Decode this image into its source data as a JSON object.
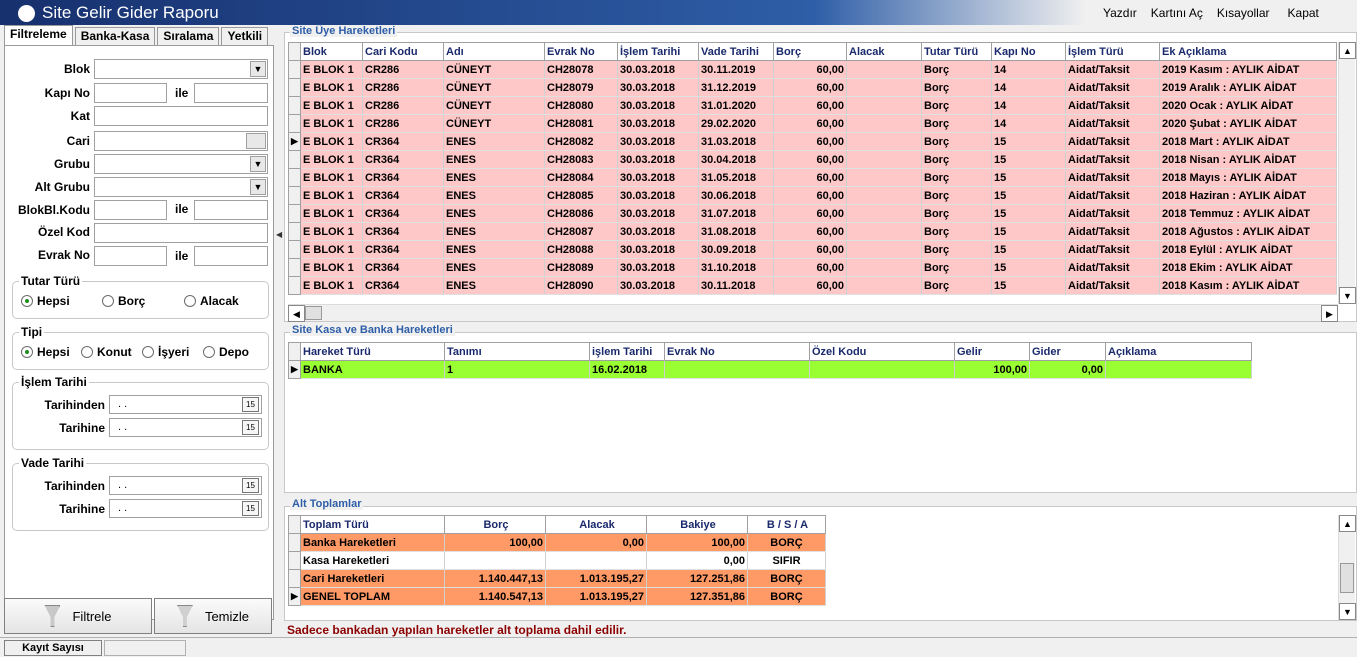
{
  "window": {
    "title": "Site Gelir Gider Raporu"
  },
  "menu": [
    "Yazdır",
    "Kartını Aç",
    "Kısayollar",
    "Kapat"
  ],
  "tabs": [
    "Filtreleme",
    "Banka-Kasa",
    "Sıralama",
    "Yetkili"
  ],
  "filters": {
    "blok": "Blok",
    "kapi_no": "Kapı No",
    "ile": "ile",
    "kat": "Kat",
    "cari": "Cari",
    "grubu": "Grubu",
    "alt_grubu": "Alt Grubu",
    "blokbl_kodu": "BlokBl.Kodu",
    "ozel_kod": "Özel Kod",
    "evrak_no": "Evrak No"
  },
  "tutar_turu": {
    "title": "Tutar Türü",
    "options": [
      "Hepsi",
      "Borç",
      "Alacak"
    ],
    "selected": "Hepsi"
  },
  "tipi": {
    "title": "Tipi",
    "options": [
      "Hepsi",
      "Konut",
      "İşyeri",
      "Depo"
    ],
    "selected": "Hepsi"
  },
  "islem_tarihi": {
    "title": "İşlem Tarihi",
    "from_label": "Tarihinden",
    "to_label": "Tarihine",
    "from_value": ". .",
    "to_value": ". ."
  },
  "vade_tarihi": {
    "title": "Vade Tarihi",
    "from_label": "Tarihinden",
    "to_label": "Tarihine",
    "from_value": ". .",
    "to_value": ". ."
  },
  "buttons": {
    "filtrele": "Filtrele",
    "temizle": "Temizle"
  },
  "uye_hareketleri": {
    "title": "Site Üye Hareketleri",
    "columns": [
      "Blok",
      "Cari Kodu",
      "Adı",
      "Evrak No",
      "İşlem Tarihi",
      "Vade Tarihi",
      "Borç",
      "Alacak",
      "Tutar Türü",
      "Kapı No",
      "İşlem Türü",
      "Ek Açıklama"
    ],
    "rows": [
      [
        "E BLOK 1",
        "CR286",
        "CÜNEYT",
        "CH28078",
        "30.03.2018",
        "30.11.2019",
        "60,00",
        "",
        "Borç",
        "14",
        "Aidat/Taksit",
        "2019 Kasım : AYLIK AİDAT"
      ],
      [
        "E BLOK 1",
        "CR286",
        "CÜNEYT",
        "CH28079",
        "30.03.2018",
        "31.12.2019",
        "60,00",
        "",
        "Borç",
        "14",
        "Aidat/Taksit",
        "2019 Aralık : AYLIK AİDAT"
      ],
      [
        "E BLOK 1",
        "CR286",
        "CÜNEYT",
        "CH28080",
        "30.03.2018",
        "31.01.2020",
        "60,00",
        "",
        "Borç",
        "14",
        "Aidat/Taksit",
        "2020 Ocak : AYLIK AİDAT"
      ],
      [
        "E BLOK 1",
        "CR286",
        "CÜNEYT",
        "CH28081",
        "30.03.2018",
        "29.02.2020",
        "60,00",
        "",
        "Borç",
        "14",
        "Aidat/Taksit",
        "2020 Şubat : AYLIK AİDAT"
      ],
      [
        "E BLOK 1",
        "CR364",
        "ENES",
        "CH28082",
        "30.03.2018",
        "31.03.2018",
        "60,00",
        "",
        "Borç",
        "15",
        "Aidat/Taksit",
        "2018 Mart : AYLIK AİDAT"
      ],
      [
        "E BLOK 1",
        "CR364",
        "ENES",
        "CH28083",
        "30.03.2018",
        "30.04.2018",
        "60,00",
        "",
        "Borç",
        "15",
        "Aidat/Taksit",
        "2018 Nisan : AYLIK AİDAT"
      ],
      [
        "E BLOK 1",
        "CR364",
        "ENES",
        "CH28084",
        "30.03.2018",
        "31.05.2018",
        "60,00",
        "",
        "Borç",
        "15",
        "Aidat/Taksit",
        "2018 Mayıs : AYLIK AİDAT"
      ],
      [
        "E BLOK 1",
        "CR364",
        "ENES",
        "CH28085",
        "30.03.2018",
        "30.06.2018",
        "60,00",
        "",
        "Borç",
        "15",
        "Aidat/Taksit",
        "2018 Haziran : AYLIK AİDAT"
      ],
      [
        "E BLOK 1",
        "CR364",
        "ENES",
        "CH28086",
        "30.03.2018",
        "31.07.2018",
        "60,00",
        "",
        "Borç",
        "15",
        "Aidat/Taksit",
        "2018 Temmuz : AYLIK AİDAT"
      ],
      [
        "E BLOK 1",
        "CR364",
        "ENES",
        "CH28087",
        "30.03.2018",
        "31.08.2018",
        "60,00",
        "",
        "Borç",
        "15",
        "Aidat/Taksit",
        "2018 Ağustos : AYLIK AİDAT"
      ],
      [
        "E BLOK 1",
        "CR364",
        "ENES",
        "CH28088",
        "30.03.2018",
        "30.09.2018",
        "60,00",
        "",
        "Borç",
        "15",
        "Aidat/Taksit",
        "2018 Eylül : AYLIK AİDAT"
      ],
      [
        "E BLOK 1",
        "CR364",
        "ENES",
        "CH28089",
        "30.03.2018",
        "31.10.2018",
        "60,00",
        "",
        "Borç",
        "15",
        "Aidat/Taksit",
        "2018 Ekim : AYLIK AİDAT"
      ],
      [
        "E BLOK 1",
        "CR364",
        "ENES",
        "CH28090",
        "30.03.2018",
        "30.11.2018",
        "60,00",
        "",
        "Borç",
        "15",
        "Aidat/Taksit",
        "2018 Kasım : AYLIK AİDAT"
      ]
    ],
    "current_row": 4
  },
  "kasa_banka": {
    "title": "Site Kasa  ve Banka Hareketleri",
    "columns": [
      "Hareket Türü",
      "Tanımı",
      "işlem Tarihi",
      "Evrak No",
      "Özel Kodu",
      "Gelir",
      "Gider",
      "Açıklama"
    ],
    "rows": [
      [
        "BANKA",
        "1",
        "16.02.2018",
        "",
        "",
        "100,00",
        "0,00",
        ""
      ]
    ]
  },
  "alt_toplamlar": {
    "title": "Alt Toplamlar",
    "columns": [
      "Toplam Türü",
      "Borç",
      "Alacak",
      "Bakiye",
      "B / S / A"
    ],
    "rows": [
      [
        "Banka Hareketleri",
        "100,00",
        "0,00",
        "100,00",
        "BORÇ"
      ],
      [
        "Kasa Hareketleri",
        "",
        "",
        "0,00",
        "SIFIR"
      ],
      [
        "Cari Hareketleri",
        "1.140.447,13",
        "1.013.195,27",
        "127.251,86",
        "BORÇ"
      ],
      [
        "GENEL TOPLAM",
        "1.140.547,13",
        "1.013.195,27",
        "127.351,86",
        "BORÇ"
      ]
    ]
  },
  "note": "Sadece bankadan yapılan hareketler alt toplama dahil edilir.",
  "status": {
    "label": "Kayıt Sayısı"
  },
  "colors": {
    "member_row": "#ffc8c8",
    "bank_row": "#99ff33",
    "total_row": "#ff9966",
    "section_title": "#2e5ea7",
    "note": "#8b0000"
  }
}
